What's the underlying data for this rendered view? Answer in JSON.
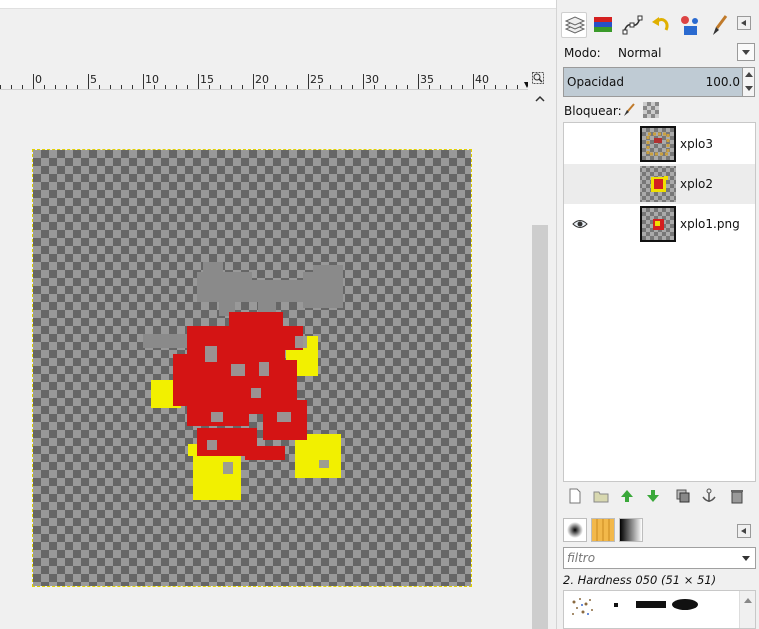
{
  "ruler": {
    "ticks": [
      "0",
      "5",
      "10",
      "15",
      "20",
      "25",
      "30",
      "35",
      "40"
    ]
  },
  "layers_panel": {
    "mode_label": "Modo:",
    "mode_value": "Normal",
    "opacity_label": "Opacidad",
    "opacity_value": "100.0",
    "lock_label": "Bloquear:",
    "layers": [
      {
        "name": "xplo3",
        "visible": false,
        "selected": false
      },
      {
        "name": "xplo2",
        "visible": false,
        "selected": true
      },
      {
        "name": "xplo1.png",
        "visible": true,
        "selected": false
      }
    ]
  },
  "brushes_panel": {
    "filter_placeholder": "filtro",
    "brush_name": "2. Hardness 050 (51 × 51)"
  },
  "colors": {
    "sprite_red": "#d41414",
    "sprite_yellow": "#f2f000",
    "sprite_gray": "#8a8a8a",
    "selection_bar": "#bfcbd4"
  }
}
